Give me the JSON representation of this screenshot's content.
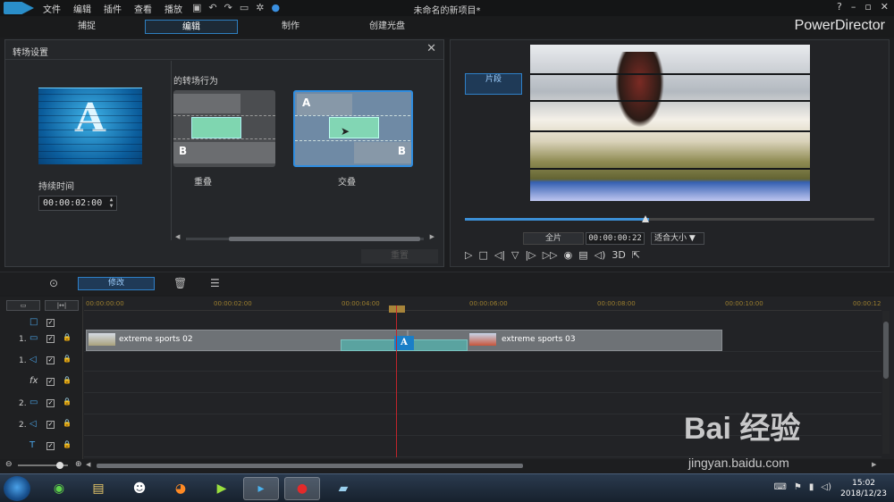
{
  "window": {
    "title": "未命名的新项目*",
    "brand": "PowerDirector"
  },
  "menu": [
    "文件",
    "编辑",
    "插件",
    "查看",
    "播放"
  ],
  "mode_tabs": [
    "捕捉",
    "编辑",
    "制作",
    "创建光盘"
  ],
  "transition_panel": {
    "title": "转场设置",
    "duration_label": "持续时间",
    "duration_value": "00:00:02:00",
    "behavior_label": "的转场行为",
    "option_overlap": "重叠",
    "option_cross": "交叠",
    "apply_label": "重置",
    "block_a": "A",
    "block_b": "B",
    "thumb_letter": "A"
  },
  "preview": {
    "seg_clip": "片段",
    "seg_full": "全片",
    "timecode": "00:00:00:22",
    "fit": "适合大小",
    "mode_3d": "3D",
    "progress_percent": 45
  },
  "toolbar": {
    "modify_label": "修改"
  },
  "timeline": {
    "ruler": [
      "00:00:00:00",
      "00:00:02:00",
      "00:00:04:00",
      "00:00:06:00",
      "00:00:08:00",
      "00:00:10:00",
      "00:00:12"
    ],
    "tracks": [
      {
        "num": "",
        "icon": "□"
      },
      {
        "num": "1.",
        "icon": "▭"
      },
      {
        "num": "1.",
        "icon": "◁"
      },
      {
        "num": "",
        "icon": "fx"
      },
      {
        "num": "2.",
        "icon": "▭"
      },
      {
        "num": "2.",
        "icon": "◁"
      },
      {
        "num": "",
        "icon": "T"
      }
    ],
    "clip1": "extreme sports 02",
    "clip2": "extreme sports 03"
  },
  "taskbar": {
    "time": "15:02",
    "date": "2018/12/23"
  },
  "watermark": {
    "main": "Bai 经验",
    "sub": "jingyan.baidu.com"
  }
}
